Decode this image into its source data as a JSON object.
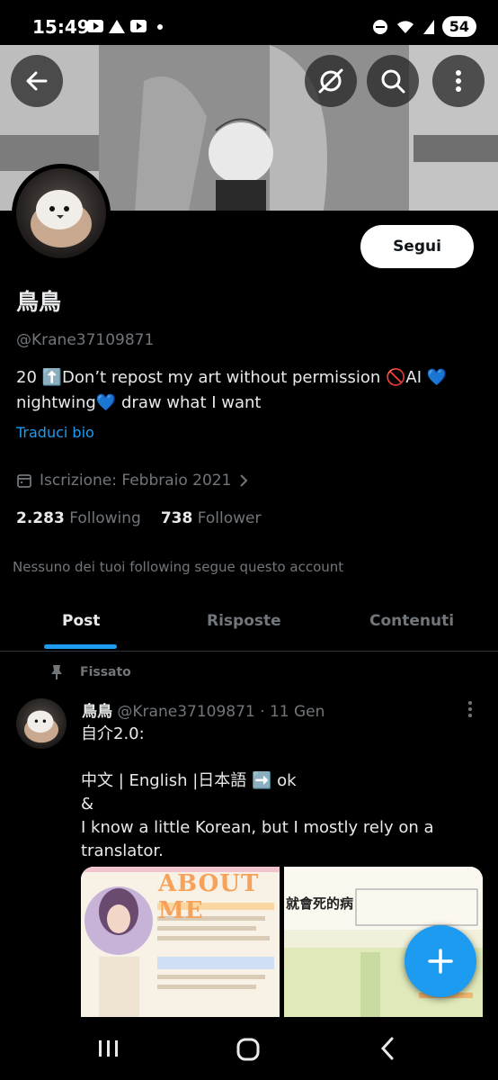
{
  "status_bar": {
    "time": "15:49",
    "battery": "54"
  },
  "profile": {
    "name": "鳥鳥",
    "handle": "@Krane37109871",
    "bio_line1": "20 ⬆️Don’t repost my art without permission 🚫AI 💙",
    "bio_line2": "nightwing💙 draw what I want",
    "translate_label": "Traduci bio",
    "joined": "Iscrizione: Febbraio 2021",
    "following_count": "2.283",
    "following_label": "Following",
    "followers_count": "738",
    "followers_label": "Follower",
    "mutual_note": "Nessuno dei tuoi following segue questo account",
    "follow_label": "Segui"
  },
  "tabs": [
    {
      "label": "Post"
    },
    {
      "label": "Risposte"
    },
    {
      "label": "Contenuti"
    }
  ],
  "post": {
    "pinned_label": "Fissato",
    "author_name": "鳥鳥",
    "author_handle": "@Krane37109871",
    "separator": "·",
    "date": "11 Gen",
    "text": "自介2.0:\n\n中文 | English |日本語 ➡️ ok\n&\nI know a little Korean, but I mostly rely on a translator.",
    "image1_title": "ABOUT ME",
    "image2_title": "就會死的病"
  },
  "colors": {
    "accent": "#1d9bf0",
    "muted": "#71767b",
    "background": "#000000"
  }
}
